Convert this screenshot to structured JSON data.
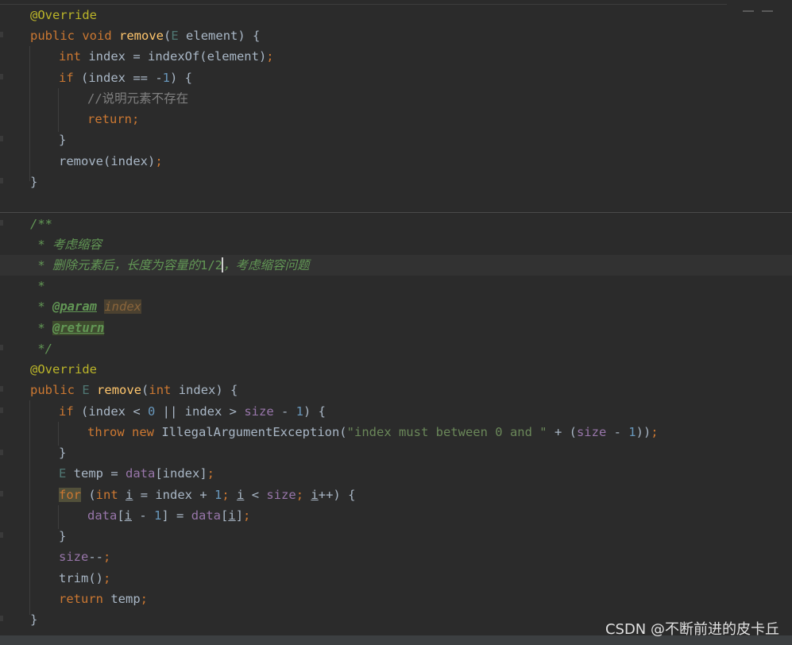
{
  "code": {
    "m1": {
      "annotation": "@Override",
      "kw_public": "public",
      "kw_void": "void",
      "method": "remove",
      "open_paren": "(",
      "param_type": "E",
      "param_rest": " element) {",
      "l2_kw_int": "int",
      "l2_text": " index = indexOf(element)",
      "l2_semi": ";",
      "l3_kw_if": "if",
      "l3_a": " (index == -",
      "l3_num": "1",
      "l3_b": ") {",
      "l4_comment": "//说明元素不存在",
      "l5_kw_return": "return",
      "l5_semi": ";",
      "l6_close": "}",
      "l7_text": "remove(index)",
      "l7_semi": ";",
      "l8_close": "}"
    },
    "doc": {
      "open": "/**",
      "line1": " * 考虑缩容",
      "line2_a": " * 删除元素后，长度为容量的",
      "line2_b": "1/2",
      "line2_c": "，考虑缩容问题",
      "star": " *",
      "star_sp": " * ",
      "param_tag": "@param",
      "param_sp": " ",
      "param_name": "index",
      "return_tag": "@return",
      "close": " */"
    },
    "m2": {
      "annotation": "@Override",
      "kw_public": "public",
      "sp": " ",
      "ret_type": "E",
      "method": "remove",
      "open_paren": "(",
      "kw_int": "int",
      "param_rest": " index) {",
      "l1_kw_if": "if",
      "l1_a": " (index < ",
      "l1_num0": "0",
      "l1_b": " || index > ",
      "l1_size": "size",
      "l1_c": " - ",
      "l1_num1": "1",
      "l1_d": ") {",
      "l2_kw_throw": "throw",
      "l2_kw_new": "new",
      "l2_ctor": " IllegalArgumentException(",
      "l2_str": "\"index must between 0 and \"",
      "l2_plus": " + (",
      "l2_size": "size",
      "l2_minus": " - ",
      "l2_num": "1",
      "l2_close": "))",
      "l2_semi": ";",
      "l3_close": "}",
      "l4_type": "E",
      "l4_a": " temp = ",
      "l4_data": "data",
      "l4_b": "[index]",
      "l4_semi": ";",
      "l5_kw_for": "for",
      "l5_a": " (",
      "l5_kw_int": "int",
      "l5_i": "i",
      "l5_b": " = index + ",
      "l5_num": "1",
      "l5_semi1": ";",
      "l5_c": " ",
      "l5_i2": "i",
      "l5_d": " < ",
      "l5_size": "size",
      "l5_semi2": ";",
      "l5_e": " ",
      "l5_i3": "i",
      "l5_f": "++) {",
      "l6_data1": "data",
      "l6_a": "[",
      "l6_i1": "i",
      "l6_b": " - ",
      "l6_num": "1",
      "l6_c": "] = ",
      "l6_data2": "data",
      "l6_d": "[",
      "l6_i2": "i",
      "l6_e": "]",
      "l6_semi": ";",
      "l7_close": "}",
      "l8_size": "size",
      "l8_a": "--",
      "l8_semi": ";",
      "l9_text": "trim()",
      "l9_semi": ";",
      "l10_kw_return": "return",
      "l10_text": " temp",
      "l10_semi": ";",
      "l11_close": "}"
    }
  },
  "watermark": "CSDN @不断前进的皮卡丘",
  "colors": {
    "background": "#2b2b2b",
    "keyword": "#cc7832",
    "method": "#ffc66d",
    "annotation": "#bbb529",
    "number": "#6897bb",
    "string": "#6a8759",
    "field": "#9876aa",
    "doc_comment": "#629755",
    "line_comment": "#808080"
  }
}
